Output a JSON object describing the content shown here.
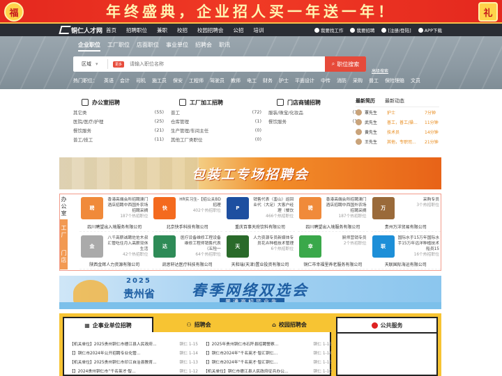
{
  "promo": {
    "text": "年终盛典，企业招人买一年送一年！",
    "left_badge": "福",
    "right_badge": "礼"
  },
  "site": {
    "logo": "铜仁人才网",
    "logo_sub": "tongrenrcw.com"
  },
  "nav": {
    "items": [
      "首页",
      "招聘职位",
      "兼职",
      "校招",
      "校园招聘会",
      "公招",
      "培训"
    ],
    "right": [
      "我要找工作",
      "我要招聘",
      "[注册/登陆]",
      "APP下载"
    ]
  },
  "search": {
    "tabs": [
      "企业职位",
      "工厂职位",
      "店面职位",
      "事业单位",
      "招聘会",
      "职讯"
    ],
    "region": "区域",
    "more": "更多",
    "placeholder": "请输入职位名称",
    "button": "职位搜索",
    "advanced": "高级搜索",
    "hot_label": "热门职位：",
    "hot": [
      "英语",
      "会计",
      "司机",
      "施工员",
      "保安",
      "工程师",
      "驾驶员",
      "教师",
      "电工",
      "财务",
      "护士",
      "平面设计",
      "中传",
      "消防",
      "采购",
      "普工",
      "保险理赔",
      "文员"
    ]
  },
  "categories": [
    {
      "title": "办公室招聘",
      "rows": [
        [
          "其它类",
          "(55)"
        ],
        [
          "医院/医疗/护理",
          "(25)"
        ],
        [
          "餐饮服务",
          "(21)"
        ],
        [
          "普工/技工",
          "(11)"
        ]
      ]
    },
    {
      "title": "工厂加工招聘",
      "rows": [
        [
          "普工",
          "(72)"
        ],
        [
          "仓库管理",
          "(1)"
        ],
        [
          "生产管理/车间主任",
          "(0)"
        ],
        [
          "其他工厂类职位",
          "(0)"
        ]
      ]
    },
    {
      "title": "门店商铺招聘",
      "rows": [
        [
          "服装/珠宝/化妆品",
          "(1)"
        ],
        [
          "餐饮服务",
          "(1)"
        ]
      ]
    }
  ],
  "news": {
    "tabs": [
      "最新简历",
      "最新动态"
    ],
    "rows": [
      {
        "name": "覃先生",
        "job": "护士",
        "time": "7分钟"
      },
      {
        "name": "武先生",
        "job": "普工，普工/操...",
        "time": "11分钟"
      },
      {
        "name": "黄先生",
        "job": "技术员",
        "time": "14分钟"
      },
      {
        "name": "王先生",
        "job": "其他，专职司...",
        "time": "21分钟"
      }
    ]
  },
  "banner1": {
    "text": "包装工专场招聘会"
  },
  "firm_side": [
    "办公室",
    "工厂",
    "门店"
  ],
  "firms": [
    {
      "desc": "香港高端会所招聘澳门酒店招聘中西国外农场招聘采摘",
      "count": "187个热招职位",
      "name": "四川聘望出入境服务有限公司",
      "color": "#f08a3a",
      "mark": "聘"
    },
    {
      "desc": "HR实习生-【招公关BD招理",
      "count": "402个热招职位",
      "name": "北京快手科技有限公司",
      "color": "#f46a1e",
      "mark": "快"
    },
    {
      "desc": "销售代表（銮山）巡回业代（大足）大客户经理（餐饮",
      "count": "466个热招职位",
      "name": "重庆百事天府饮料有限公司",
      "color": "#1e4fa0",
      "mark": "P"
    },
    {
      "desc": "香港高端会所招聘澳门酒店招聘中西国外农场招聘采摘",
      "count": "187个热招职位",
      "name": "四川聘望出入境服务有限公司",
      "color": "#f08a3a",
      "mark": "聘"
    },
    {
      "desc": "采购专员",
      "count": "3个热招职位",
      "name": "贵州万洋贸易有限公司",
      "color": "#9a6a3a",
      "mark": "万"
    },
    {
      "desc": "八千高薪诚聘佐佐木叔汇管吃住月入高薪双休生活",
      "count": "42个热招职位",
      "name": "陕西金辉人力资源有限公司",
      "color": "#aaaaaa",
      "mark": "金"
    },
    {
      "desc": "医疗设备维修工程设备维修工程师销售代表（五险一",
      "count": "64个热招职位",
      "name": "凯思轩达医疗科技有限公司",
      "color": "#2e8b57",
      "mark": "达"
    },
    {
      "desc": "人力资源专员新媒体专员花卉种植技术管理",
      "count": "6个热招职位",
      "name": "天和瑞(天津)置业投资有限公司",
      "color": "#2a6a2a",
      "mark": "天"
    },
    {
      "desc": "厨师营销专员",
      "count": "2个热招职位",
      "name": "铜仁市幸福里养老服务有限公司",
      "color": "#3aa84a",
      "mark": "幸"
    },
    {
      "desc": "国际水手15万年国际水手15万年远洋种植技术船员15",
      "count": "16个热招职位",
      "name": "天联国际海运有限公司",
      "color": "#1d8fd8",
      "mark": "联"
    }
  ],
  "banner2": {
    "year": "2025",
    "province": "贵州省",
    "title": "春季网络双选会",
    "subtitle": "普通高校毕业生"
  },
  "bottom": {
    "tabs": [
      "企事业单位招聘",
      "招聘会",
      "校园招聘会"
    ],
    "public": "公共服务",
    "left_list": [
      {
        "title": "【机关单位】2025贵州铜仁市德江县人民政府...",
        "date": "铜仁 1-15"
      },
      {
        "title": "【】铜仁市2024年公开招聘专业化管...",
        "date": "铜仁 1-14"
      },
      {
        "title": "【机关单位】2025贵州铜仁市印江自治县教育...",
        "date": "铜仁 1-13"
      },
      {
        "title": "【】2024贵州铜仁市“千名英才·智...",
        "date": "铜仁 1-12"
      }
    ],
    "right_list": [
      {
        "title": "【】2025年贵州铜仁市石阡县招聘警察...",
        "date": "铜仁 1-15"
      },
      {
        "title": "【】铜仁市2024年“千名英才·智汇铜仁...",
        "date": "铜仁 1-14"
      },
      {
        "title": "【】铜仁市2024年“千名英才·智汇铜仁...",
        "date": "铜仁 1-13"
      },
      {
        "title": "【机关单位】铜仁市德江县人民政府征兵办公...",
        "date": "铜仁 1-10"
      }
    ]
  }
}
